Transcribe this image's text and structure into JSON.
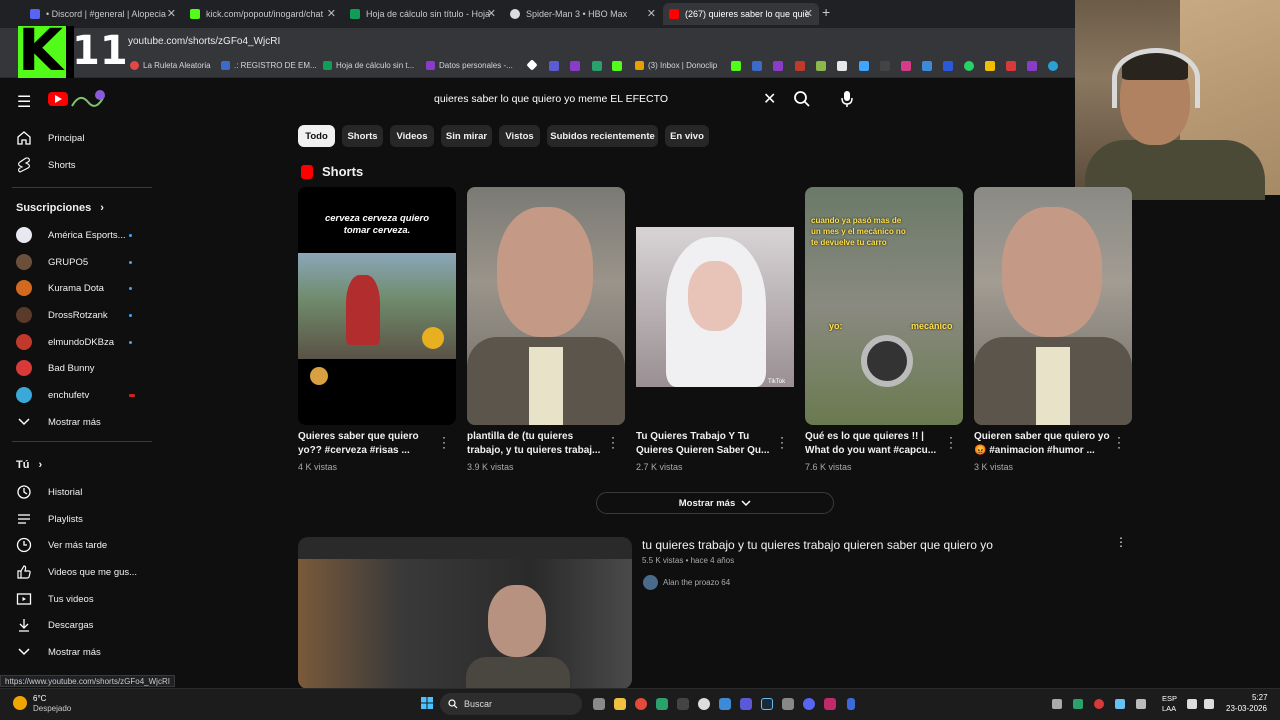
{
  "browser": {
    "tabs": [
      {
        "label": "• Discord | #general | Alopecia",
        "color": "#5865f2"
      },
      {
        "label": "kick.com/popout/inogard/chat",
        "color": "#53fc18"
      },
      {
        "label": "Hoja de cálculo sin título - Hoja",
        "color": "#0f9d58"
      },
      {
        "label": "Spider-Man 3 • HBO Max",
        "color": "#dddddd"
      },
      {
        "label": "(267) quieres saber lo que quie",
        "color": "#ff0000"
      }
    ],
    "url": "youtube.com/shorts/zGFo4_WjcRI",
    "bookmarks": [
      {
        "label": "La Ruleta Aleatoria",
        "color": "#e04848"
      },
      {
        "label": ".: REGISTRO DE EM...",
        "color": "#3c6ac8"
      },
      {
        "label": "Hoja de cálculo sin t...",
        "color": "#0f9d58"
      },
      {
        "label": "Datos personales -...",
        "color": "#8a3cc8"
      },
      {
        "label": "(3) Inbox | Donoclip",
        "color": "#e8a000"
      }
    ]
  },
  "overlay": {
    "logo_letter": "K",
    "logo_number": "11"
  },
  "search": {
    "query": "quieres saber lo que quiero yo meme EL EFECTO"
  },
  "chips": [
    "Todo",
    "Shorts",
    "Videos",
    "Sin mirar",
    "Vistos",
    "Subidos recientemente",
    "En vivo"
  ],
  "sidebar": {
    "main": [
      {
        "label": "Principal",
        "icon": "home-icon"
      },
      {
        "label": "Shorts",
        "icon": "shorts-icon"
      }
    ],
    "subs_header": "Suscripciones",
    "subs_chevron": "›",
    "subscriptions": [
      {
        "label": "América Esports...",
        "color": "#e8e8f0",
        "dot": "#3ea6ff"
      },
      {
        "label": "GRUPO5",
        "color": "#6b4f3a",
        "dot": "#3ea6ff"
      },
      {
        "label": "Kurama Dota",
        "color": "#d2691e",
        "dot": "#3ea6ff"
      },
      {
        "label": "DrossRotzank",
        "color": "#5a3a2a",
        "dot": "#3ea6ff"
      },
      {
        "label": "elmundoDKBza",
        "color": "#c0392b",
        "dot": "#3ea6ff"
      },
      {
        "label": "Bad Bunny",
        "color": "#d83a3a",
        "dot": ""
      },
      {
        "label": "enchufetv",
        "color": "#3aa8d8",
        "dot": "#cc2222"
      }
    ],
    "subs_more": "Mostrar más",
    "you_header": "Tú",
    "you": [
      {
        "label": "Historial",
        "icon": "history-icon"
      },
      {
        "label": "Playlists",
        "icon": "playlist-icon"
      },
      {
        "label": "Ver más tarde",
        "icon": "clock-icon"
      },
      {
        "label": "Videos que me gus...",
        "icon": "thumbs-up-icon"
      },
      {
        "label": "Tus videos",
        "icon": "video-icon"
      },
      {
        "label": "Descargas",
        "icon": "download-icon"
      }
    ],
    "you_more": "Mostrar más"
  },
  "shorts": {
    "title": "Shorts",
    "items": [
      {
        "title1": "Quieres saber que quiero",
        "title2": "yo?? #cerveza #risas ...",
        "views": "4 K vistas",
        "caption1": "cerveza cerveza quiero",
        "caption2": "tomar cerveza."
      },
      {
        "title1": "plantilla de (tu quieres",
        "title2": "trabajo, y tu quieres trabaj...",
        "views": "3.9 K vistas"
      },
      {
        "title1": "Tu Quieres Trabajo Y Tu",
        "title2": "Quieres Quieren Saber Qu...",
        "views": "2.7 K vistas",
        "caption1": "TikTok"
      },
      {
        "title1": "Qué es lo que quieres !! |",
        "title2": "What do you want  #capcu...",
        "views": "7.6 K vistas",
        "caption1": "cuando ya pasó mas de un mes y el mecánico no te devuelve tu carro",
        "caption2": "yo:",
        "caption3": "mecánico"
      },
      {
        "title1": "Quieren saber que quiero yo",
        "title2": "😡 #animacion #humor ...",
        "views": "3 K vistas"
      }
    ],
    "show_more": "Mostrar más"
  },
  "video": {
    "title": "tu quieres trabajo y tu quieres trabajo quieren saber que quiero yo",
    "meta": "5.5 K vistas • hace 4 años",
    "channel": "Alan the proazo 64"
  },
  "status_url": "https://www.youtube.com/shorts/zGFo4_WjcRI",
  "taskbar": {
    "weather_temp": "6°C",
    "weather_desc": "Despejado",
    "search_placeholder": "Buscar",
    "lang1": "ESP",
    "lang2": "LAA",
    "time": "5:27",
    "date": "23-03-2026"
  }
}
